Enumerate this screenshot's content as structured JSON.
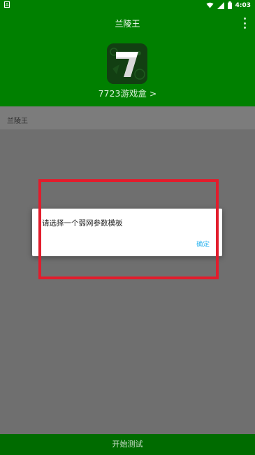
{
  "status_bar": {
    "notification_icon": "A",
    "time": "4:03",
    "icons": [
      "wifi-icon",
      "signal-icon",
      "battery-icon"
    ]
  },
  "header": {
    "title": "兰陵王",
    "menu_icon": "more-vert-icon",
    "app_link": "7723游戏盒 >"
  },
  "list": {
    "items": [
      {
        "label": "兰陵王"
      }
    ]
  },
  "dialog": {
    "message": "请选择一个弱网参数模板",
    "ok_label": "确定"
  },
  "bottom": {
    "button_label": "开始测试"
  },
  "colors": {
    "primary_green": "#008000",
    "bottom_green": "#006b00",
    "overlay_gray": "#6f6f6f",
    "dialog_ok": "#35b7f0",
    "highlight_red": "#e21c2c"
  }
}
